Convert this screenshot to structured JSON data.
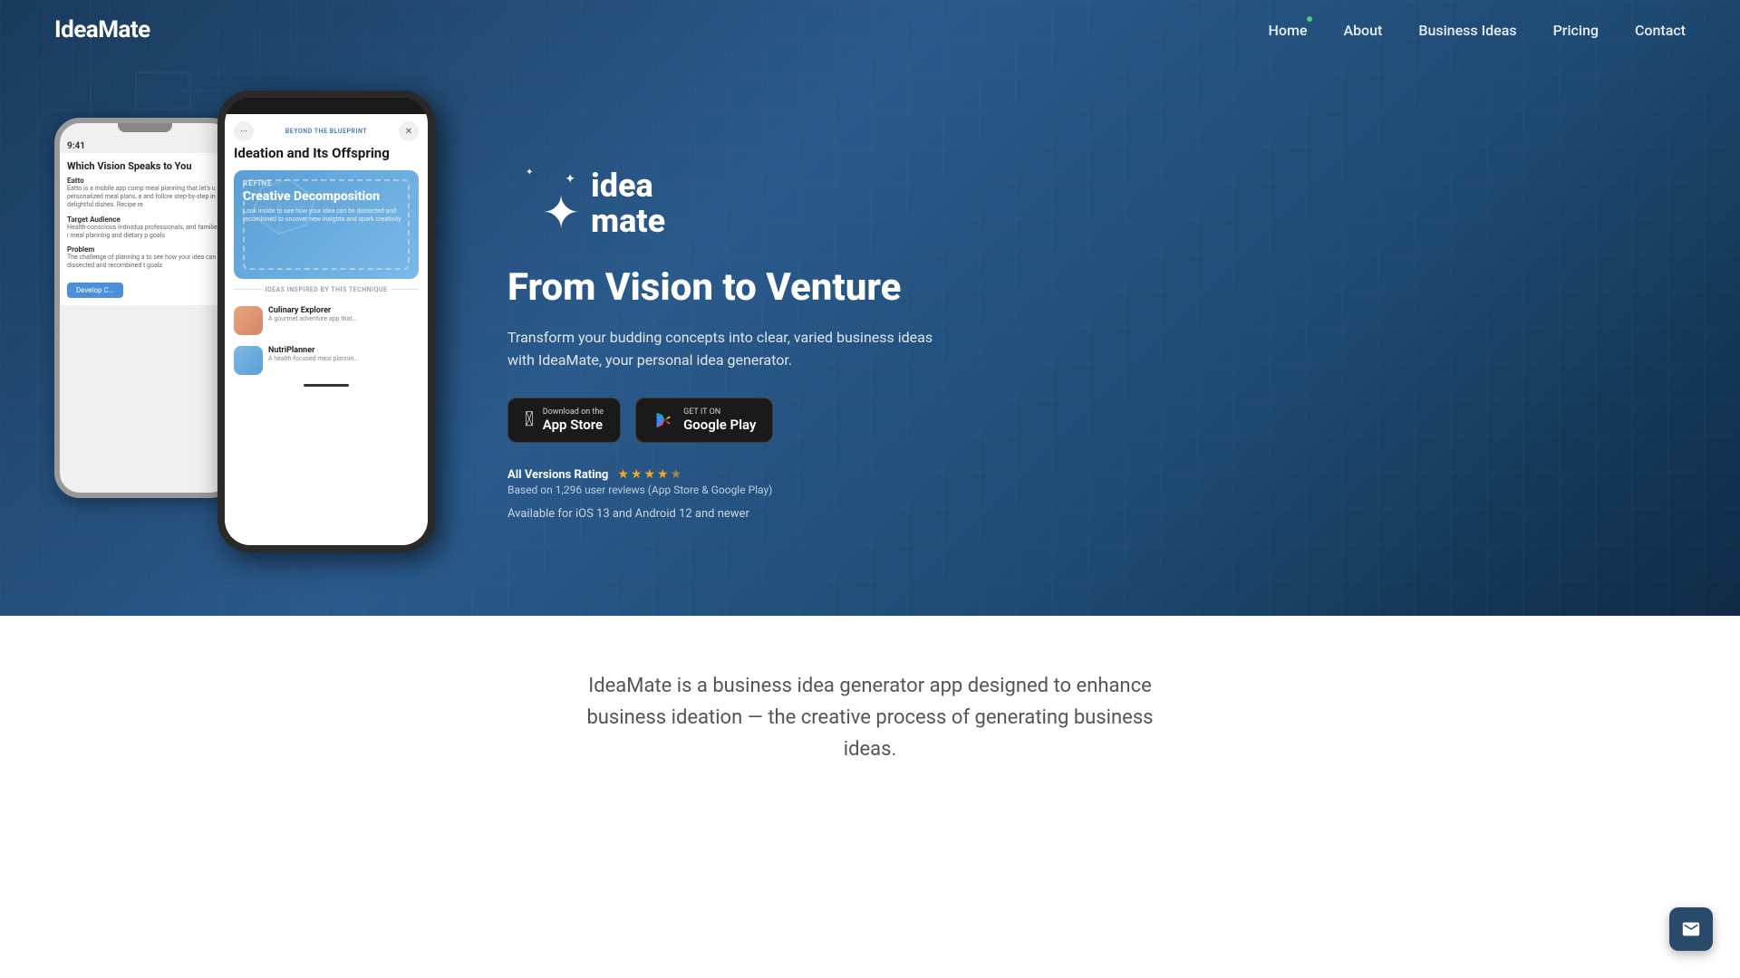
{
  "navbar": {
    "logo": "IdeaMate",
    "links": [
      {
        "id": "home",
        "label": "Home",
        "active": true
      },
      {
        "id": "about",
        "label": "About",
        "active": false
      },
      {
        "id": "business-ideas",
        "label": "Business Ideas",
        "active": false
      },
      {
        "id": "pricing",
        "label": "Pricing",
        "active": false
      },
      {
        "id": "contact",
        "label": "Contact",
        "active": false
      }
    ]
  },
  "hero": {
    "app_logo_text": "idea\nmate",
    "headline": "From Vision to Venture",
    "subtext": "Transform your budding concepts into clear, varied business ideas with IdeaMate, your personal idea generator.",
    "app_store": {
      "label_small": "Download on the",
      "label_large": "App Store"
    },
    "google_play": {
      "label_small": "GET IT ON",
      "label_large": "Google Play"
    },
    "rating": {
      "label": "All Versions Rating",
      "stars": 4.5,
      "review_text": "Based on 1,296 user reviews (App Store & Google Play)"
    },
    "platform": "Available for iOS 13 and Android 12 and newer"
  },
  "phone_front": {
    "badge": "BEYOND THE BLUEPRINT",
    "title": "Ideation and Its Offspring",
    "card": {
      "refine_label": "REFINE",
      "title": "Creative Decomposition",
      "desc": "Look inside to see how your idea can be dissected and recombined to uncover new insights and spark creativity"
    },
    "divider_text": "IDEAS INSPIRED BY THIS TECHNIQUE",
    "ideas": [
      {
        "title": "Culinary Explorer",
        "desc": "A gourmet adventure app that..."
      },
      {
        "title": "NutriPlanner",
        "desc": "A health-focused meal plannin..."
      }
    ]
  },
  "phone_back": {
    "time": "9:41",
    "title": "Which Vision Speaks to You",
    "sections": [
      {
        "name": "Eatto",
        "desc": "Eatto is a mobile app comp meal planning that let's u personalized meal plans, e and follow step-by-step in delightful dishes. Recipe re"
      },
      {
        "name": "Target Audience",
        "desc": "Health-conscious individua professionals, and families i meal planning and dietary p goals"
      },
      {
        "name": "Problem",
        "desc": "The challenge of planning a to see how your idea can b dissected and recombined t goals"
      }
    ],
    "btn_label": "Develop C..."
  },
  "bottom": {
    "text": "IdeaMate is a business idea generator app designed to enhance business ideation — the creative process of generating business ideas."
  },
  "email_fab": {
    "aria_label": "Contact via email"
  }
}
